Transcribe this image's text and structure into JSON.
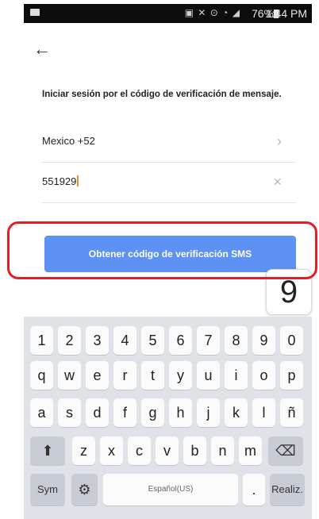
{
  "status_bar": {
    "battery_percent": "76%",
    "time": "1:44 PM",
    "icons": [
      "notification-icon",
      "nfc-icon",
      "alarm-icon",
      "wifi-icon",
      "signal-icon",
      "battery-icon"
    ]
  },
  "header": {
    "back_label": "←"
  },
  "form": {
    "instruction": "Iniciar sesión por el código de verificación de mensaje.",
    "country_value": "Mexico +52",
    "country_chevron": "›",
    "phone_value": "551929",
    "clear_icon_label": "×"
  },
  "sms_button_label": "Obtener código de verificación SMS",
  "key_preview": "9",
  "keyboard": {
    "row1": [
      "1",
      "2",
      "3",
      "4",
      "5",
      "6",
      "7",
      "8",
      "9",
      "0"
    ],
    "row2": [
      "q",
      "w",
      "e",
      "r",
      "t",
      "y",
      "u",
      "i",
      "o",
      "p"
    ],
    "row3": [
      "a",
      "s",
      "d",
      "f",
      "g",
      "h",
      "j",
      "k",
      "l",
      "ñ"
    ],
    "row4": [
      "z",
      "x",
      "c",
      "v",
      "b",
      "n",
      "m"
    ],
    "sym_label": "Sym",
    "space_label": "Español(US)",
    "period_label": ".",
    "enter_label": "Realiz."
  }
}
